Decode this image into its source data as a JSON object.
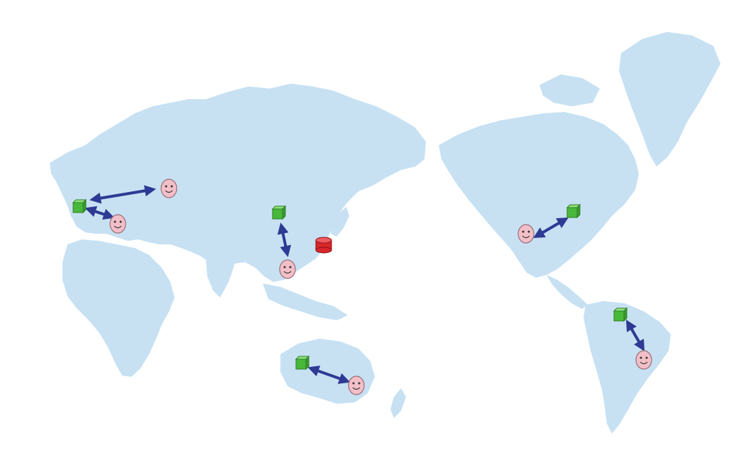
{
  "colors": {
    "background": "#ffffff",
    "land": "#c7e1f3",
    "server_green": "#49b83a",
    "server_green_top": "#8fe07a",
    "server_red": "#d8262a",
    "user_face": "#f2bfc8",
    "arrow": "#2e3a94"
  },
  "regions": [
    {
      "name": "europe-north",
      "server": "green-cube",
      "user": "smiley-user",
      "link": "bidirectional-arrow"
    },
    {
      "name": "europe-south",
      "server": "green-cube",
      "user": "smiley-user",
      "link": "bidirectional-arrow"
    },
    {
      "name": "east-asia",
      "server": "green-cube",
      "user": "smiley-user",
      "link": "bidirectional-arrow"
    },
    {
      "name": "australia",
      "server": "green-cube",
      "user": "smiley-user",
      "link": "bidirectional-arrow"
    },
    {
      "name": "north-america",
      "server": "green-cube",
      "user": "smiley-user",
      "link": "bidirectional-arrow"
    },
    {
      "name": "south-america",
      "server": "green-cube",
      "user": "smiley-user",
      "link": "bidirectional-arrow"
    },
    {
      "name": "japan",
      "server": "red-cylinder",
      "user": null,
      "link": null
    }
  ]
}
